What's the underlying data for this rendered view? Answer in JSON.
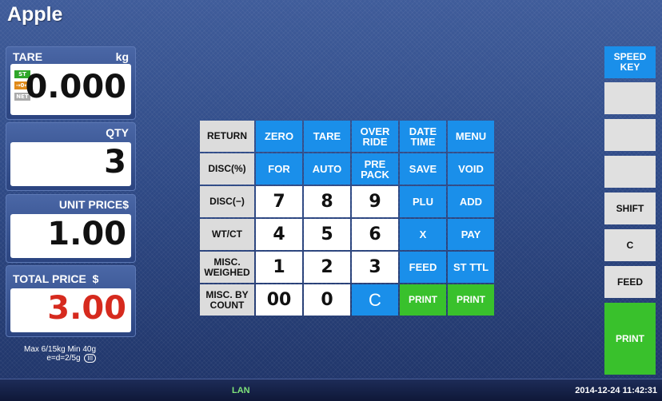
{
  "title": "Apple",
  "panels": {
    "tare": {
      "label": "TARE",
      "unit": "kg",
      "value": "0.000",
      "indicators": [
        "ST",
        "→0←",
        "NET"
      ]
    },
    "qty": {
      "label": "QTY",
      "value": "3"
    },
    "unit_price": {
      "label": "UNIT PRICE$",
      "value": "1.00"
    },
    "total_price": {
      "label": "TOTAL PRICE  $",
      "value": "3.00"
    }
  },
  "capacity": {
    "line1": "Max 6/15kg Min 40g",
    "line2": "e=d=2/5g",
    "class": "III"
  },
  "keypad": {
    "rows": [
      [
        "RETURN",
        "ZERO",
        "TARE",
        "OVER RIDE",
        "DATE TIME",
        "MENU"
      ],
      [
        "DISC(%)",
        "FOR",
        "AUTO",
        "PRE PACK",
        "SAVE",
        "VOID"
      ],
      [
        "DISC(−)",
        "7",
        "8",
        "9",
        "PLU",
        "ADD"
      ],
      [
        "WT/CT",
        "4",
        "5",
        "6",
        "X",
        "PAY"
      ],
      [
        "MISC. WEIGHED",
        "1",
        "2",
        "3",
        "FEED",
        "ST TTL"
      ],
      [
        "MISC. BY COUNT",
        "00",
        "0",
        "C",
        "PRINT",
        "PRINT"
      ]
    ]
  },
  "right_keys": {
    "speed_key": "SPEED KEY",
    "shift": "SHIFT",
    "c": "C",
    "feed": "FEED",
    "print": "PRINT"
  },
  "status": {
    "lan": "LAN",
    "datetime": "2014-12-24 11:42:31"
  },
  "colors": {
    "blue_key": "#1a8fea",
    "green_key": "#39c12c",
    "total_price": "#d62a1e"
  }
}
